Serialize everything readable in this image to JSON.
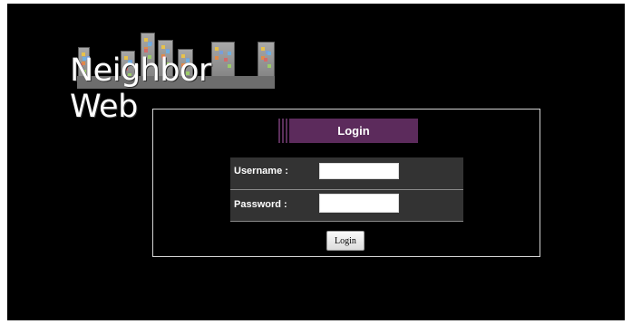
{
  "logo": {
    "text": "Neighbor Web"
  },
  "login": {
    "title": "Login",
    "username_label": "Username :",
    "username_value": "",
    "password_label": "Password :",
    "password_value": "",
    "button_label": "Login"
  },
  "colors": {
    "background": "#000000",
    "title_bar": "#5c2b5c",
    "form_bg": "#333333",
    "panel_border": "#d4d4d4"
  }
}
